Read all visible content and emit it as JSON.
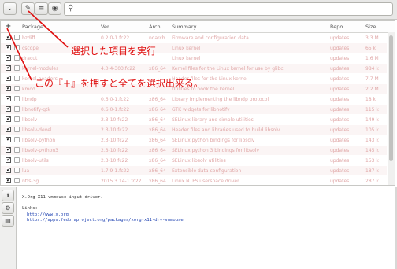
{
  "toolbar": {
    "buttons": [
      {
        "name": "dropdown-button",
        "glyph": "⌄"
      },
      {
        "name": "wrench-button",
        "glyph": "✎"
      },
      {
        "name": "list-button",
        "glyph": "≡"
      },
      {
        "name": "record-button",
        "glyph": "◉"
      }
    ],
    "search_icon": "⚲",
    "search_value": ""
  },
  "table": {
    "select_all": "+",
    "headers": [
      "Package",
      "Ver.",
      "Arch.",
      "Summary",
      "Repo.",
      "Size."
    ],
    "rows": [
      {
        "pkg": "bzdiff",
        "ver": "0.2.0-1.fc22",
        "arch": "noarch",
        "sum": "Firmware and configuration data",
        "repo": "updates",
        "size": "3.3 M",
        "checked": "✔"
      },
      {
        "pkg": "cscope",
        "ver": "",
        "arch": "",
        "sum": "Linux kernel",
        "repo": "updates",
        "size": "65 k",
        "checked": "✔"
      },
      {
        "pkg": "dracut",
        "ver": "",
        "arch": "",
        "sum": "Linux kernel",
        "repo": "updates",
        "size": "1.6 M",
        "checked": "✔"
      },
      {
        "pkg": "kernel-modules",
        "ver": "4.0.4-303.fc22",
        "arch": "x86_64",
        "sum": "Kernel files for the Linux kernel for use by glibc",
        "repo": "updates",
        "size": "984 k",
        "checked": "✔"
      },
      {
        "pkg": "kernel-headers",
        "ver": "",
        "arch": "",
        "sum": "Header files for the Linux kernel",
        "repo": "updates",
        "size": "7.7 M",
        "checked": "✔"
      },
      {
        "pkg": "kmod",
        "ver": "",
        "arch": "",
        "sum": "Utilities to hook the kernel",
        "repo": "updates",
        "size": "2.2 M",
        "checked": "✔"
      },
      {
        "pkg": "libndp",
        "ver": "0.6.0-1.fc22",
        "arch": "x86_64",
        "sum": "Library implementing the libndp protocol",
        "repo": "updates",
        "size": "18 k",
        "checked": "✔"
      },
      {
        "pkg": "libnotify-gtk",
        "ver": "0.6.0-1.fc22",
        "arch": "x86_64",
        "sum": "GTK widgets for libnotify",
        "repo": "updates",
        "size": "115 k",
        "checked": "✔"
      },
      {
        "pkg": "libsolv",
        "ver": "2.3-10.fc22",
        "arch": "x86_64",
        "sum": "SELinux library and simple utilities",
        "repo": "updates",
        "size": "149 k",
        "checked": "✔"
      },
      {
        "pkg": "libsolv-devel",
        "ver": "2.3-10.fc22",
        "arch": "x86_64",
        "sum": "Header files and libraries used to build libsolv",
        "repo": "updates",
        "size": "105 k",
        "checked": "✔"
      },
      {
        "pkg": "libsolv-python",
        "ver": "2.3-10.fc22",
        "arch": "x86_64",
        "sum": "SELinux python bindings for libsolv",
        "repo": "updates",
        "size": "143 k",
        "checked": "✔"
      },
      {
        "pkg": "libsolv-python3",
        "ver": "2.3-10.fc22",
        "arch": "x86_64",
        "sum": "SELinux python 3 bindings for libsolv",
        "repo": "updates",
        "size": "145 k",
        "checked": "✔"
      },
      {
        "pkg": "libsolv-utils",
        "ver": "2.3-10.fc22",
        "arch": "x86_64",
        "sum": "SELinux libsolv utilities",
        "repo": "updates",
        "size": "153 k",
        "checked": "✔"
      },
      {
        "pkg": "lua",
        "ver": "1.7.9-1.fc22",
        "arch": "x86_64",
        "sum": "Extensible data configuration",
        "repo": "updates",
        "size": "187 k",
        "checked": "✔"
      },
      {
        "pkg": "ntfs-3g",
        "ver": "2015.3.14-1.fc22",
        "arch": "x86_64",
        "sum": "Linux NTFS userspace driver",
        "repo": "updates",
        "size": "287 k",
        "checked": "✔"
      }
    ]
  },
  "annotations": {
    "select_item": "選択した項目を実行",
    "select_all": "この『+』を押すと全てを選択出来る。"
  },
  "info": {
    "description": "X.Org X11 vmmouse input driver.",
    "links_label": "Links:",
    "link1": "http://www.x.org",
    "link2": "https://apps.fedoraproject.org/packages/xorg-x11-drv-vmmouse"
  },
  "sidebar": [
    {
      "name": "info-icon",
      "glyph": "ℹ"
    },
    {
      "name": "settings-icon",
      "glyph": "⚙"
    },
    {
      "name": "notes-icon",
      "glyph": "▤"
    }
  ],
  "colors": {
    "annotation": "#e01010",
    "row_text": "#e0a7a7"
  }
}
